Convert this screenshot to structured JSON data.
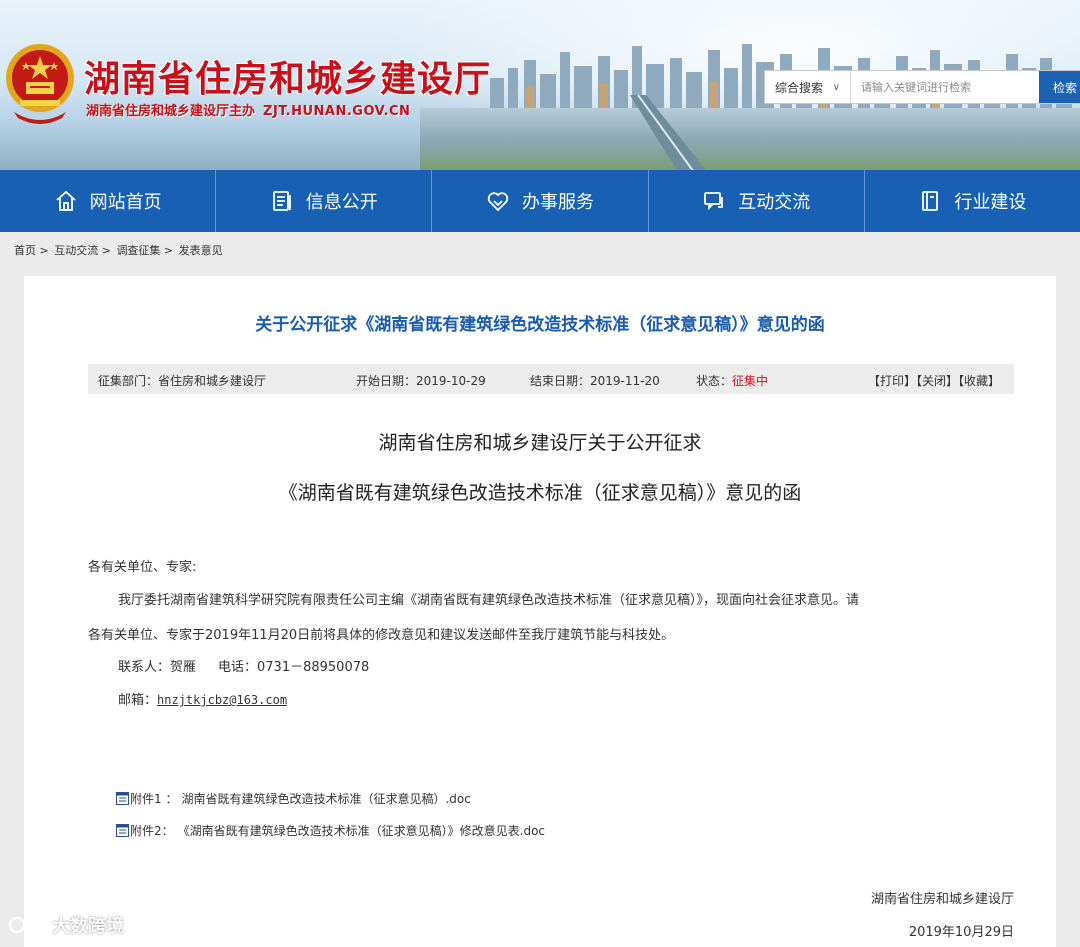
{
  "header": {
    "site_title": "湖南省住房和城乡建设厅",
    "site_sub": "湖南省住房和城乡建设厅主办",
    "domain": "ZJT.HUNAN.GOV.CN",
    "search": {
      "type_label": "综合搜索",
      "placeholder": "请输入关键词进行检索",
      "button_label": "检索"
    }
  },
  "nav": {
    "items": [
      {
        "label": "网站首页",
        "icon": "home-icon"
      },
      {
        "label": "信息公开",
        "icon": "document-icon"
      },
      {
        "label": "办事服务",
        "icon": "heart-icon"
      },
      {
        "label": "互动交流",
        "icon": "chat-icon"
      },
      {
        "label": "行业建设",
        "icon": "book-icon"
      }
    ]
  },
  "breadcrumb": [
    "首页 >",
    "互动交流 >",
    "调查征集 >",
    "发表意见"
  ],
  "article": {
    "headline": "关于公开征求《湖南省既有建筑绿色改造技术标准（征求意见稿）》意见的函",
    "info": {
      "dept": "征集部门：省住房和城乡建设厅",
      "start": "开始日期：2019-10-29",
      "end": "结束日期：2019-11-20",
      "status_label": "状态：",
      "status_value": "征集中",
      "actions": [
        "【打印】",
        "【关闭】",
        "【收藏】"
      ]
    },
    "title_line1": "湖南省住房和城乡建设厅关于公开征求",
    "title_line2": "《湖南省既有建筑绿色改造技术标准（征求意见稿）》意见的函",
    "salutation": "各有关单位、专家:",
    "para1": "我厅委托湖南省建筑科学研究院有限责任公司主编《湖南省既有建筑绿色改造技术标准（征求意见稿）》，现面向社会征求意见。请",
    "para2": "各有关单位、专家于2019年11月20日前将具体的修改意见和建议发送邮件至我厅建筑节能与科技处。",
    "contact_person": "联系人：贺雁",
    "contact_phone": "电话：0731－88950078",
    "email_label": "邮箱：",
    "email": "hnzjtkjcbz@163.com",
    "attachments": [
      {
        "label": "附件1 ：",
        "file": "湖南省既有建筑绿色改造技术标准（征求意见稿）.doc"
      },
      {
        "label": "附件2：",
        "file": "《湖南省既有建筑绿色改造技术标准（征求意见稿）》修改意见表.doc"
      }
    ],
    "signer": "湖南省住房和城乡建设厅",
    "sign_date": "2019年10月29日"
  },
  "watermark": "大数跨境",
  "colors": {
    "brand_red": "#c7101a",
    "nav_blue": "#1760b4",
    "headline_blue": "#1a5ab0",
    "status_red": "#d6131d"
  }
}
